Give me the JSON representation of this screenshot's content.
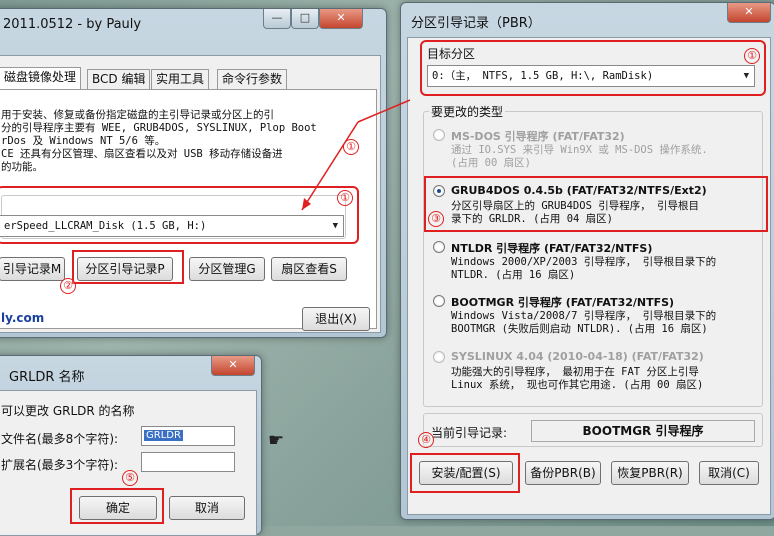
{
  "main_window": {
    "title": "2011.0512 - by Pauly",
    "tabs": [
      "磁盘镜像处理",
      "BCD 编辑",
      "实用工具",
      "命令行参数"
    ],
    "description": [
      "用于安装、修复或备份指定磁盘的主引导记录或分区上的引",
      "分的引导程序主要有 WEE, GRUB4DOS, SYSLINUX, Plop Boot",
      "rDos 及 Windows NT 5/6 等。",
      "CE 还具有分区管理、扇区查看以及对 USB 移动存储设备进",
      "的功能。"
    ],
    "disk_combo": "erSpeed_LLCRAM_Disk (1.5 GB, H:)",
    "buttons": {
      "mbr": "引导记录M",
      "pbr": "分区引导记录P",
      "part_mgr": "分区管理G",
      "sector_view": "扇区查看S",
      "exit": "退出(X)"
    },
    "website": "ly.com"
  },
  "pbr_window": {
    "title": "分区引导记录（PBR）",
    "target_label": "目标分区",
    "target_value": "0:（主，  NTFS,   1.5 GB, H:\\, RamDisk)",
    "type_label": "要更改的类型",
    "options": [
      {
        "title": "MS-DOS 引导程序 (FAT/FAT32)",
        "desc": "通过 IO.SYS 来引导 Win9X 或 MS-DOS 操作系统.\n(占用 00 扇区)",
        "enabled": false,
        "checked": false
      },
      {
        "title": "GRUB4DOS 0.4.5b (FAT/FAT32/NTFS/Ext2)",
        "desc": "分区引导扇区上的 GRUB4DOS 引导程序， 引导根目\n录下的 GRLDR. (占用 04 扇区)",
        "enabled": true,
        "checked": true
      },
      {
        "title": "NTLDR 引导程序 (FAT/FAT32/NTFS)",
        "desc": "Windows 2000/XP/2003 引导程序， 引导根目录下的\nNTLDR. (占用 16 扇区)",
        "enabled": true,
        "checked": false
      },
      {
        "title": "BOOTMGR 引导程序 (FAT/FAT32/NTFS)",
        "desc": "Windows Vista/2008/7 引导程序， 引导根目录下的\nBOOTMGR (失败后则启动 NTLDR). (占用 16 扇区)",
        "enabled": true,
        "checked": false
      },
      {
        "title": "SYSLINUX 4.04 (2010-04-18) (FAT/FAT32)",
        "desc": "功能强大的引导程序， 最初用于在 FAT 分区上引导\nLinux 系统， 现也可作其它用途. (占用 00 扇区)",
        "enabled": false,
        "checked": false
      }
    ],
    "current_label": "当前引导记录:",
    "current_value": "BOOTMGR 引导程序",
    "buttons": {
      "install": "安装/配置(S)",
      "backup": "备份PBR(B)",
      "restore": "恢复PBR(R)",
      "cancel": "取消(C)"
    }
  },
  "grldr_window": {
    "title": "GRLDR 名称",
    "description": "可以更改 GRLDR 的名称",
    "filename_label": "文件名(最多8个字符):",
    "filename_value": "GRLDR",
    "ext_label": "扩展名(最多3个字符):",
    "ext_value": "",
    "buttons": {
      "ok": "确定",
      "cancel": "取消"
    }
  },
  "markers": [
    "①",
    "①",
    "②",
    "①",
    "③",
    "④",
    "⑤"
  ],
  "colors": {
    "annotation": "#e02020",
    "desktop": "#8fa79f",
    "titlebar": "#c7d7e2"
  }
}
